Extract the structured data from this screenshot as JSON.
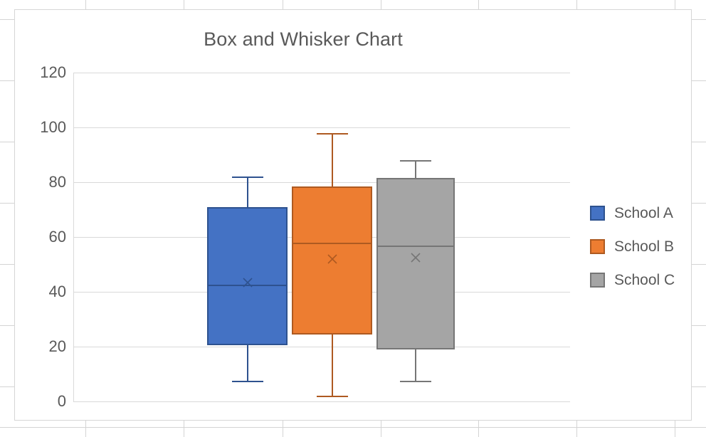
{
  "app": {
    "background_type": "spreadsheet-grid",
    "grid_color": "#d4d4d4",
    "chart_border_color": "#d6d6d6"
  },
  "chart": {
    "title": "Box and Whisker Chart",
    "title_color": "#595959",
    "axis_label_color": "#595959",
    "gridline_color": "#d9d9d9",
    "legend_position": "right"
  },
  "legend": {
    "items": [
      {
        "label": "School A",
        "color": "#4472C4",
        "border": "#2E528F"
      },
      {
        "label": "School B",
        "color": "#ED7D31",
        "border": "#AE5A21"
      },
      {
        "label": "School C",
        "color": "#A5A5A5",
        "border": "#767676"
      }
    ]
  },
  "y_axis": {
    "ticks": [
      "0",
      "20",
      "40",
      "60",
      "80",
      "100",
      "120"
    ],
    "min": 0,
    "max": 120,
    "step": 20
  },
  "chart_data": {
    "type": "box",
    "title": "Box and Whisker Chart",
    "xlabel": "",
    "ylabel": "",
    "ylim": [
      0,
      120
    ],
    "ytick_step": 20,
    "grid": true,
    "legend_position": "right",
    "categories": [
      "School A",
      "School B",
      "School C"
    ],
    "series": [
      {
        "name": "School A",
        "color": "#4472C4",
        "border_color": "#2E528F",
        "min": 7,
        "q1": 20.5,
        "median": 42.5,
        "mean": 43.5,
        "q3": 71,
        "max": 82
      },
      {
        "name": "School B",
        "color": "#ED7D31",
        "border_color": "#AE5A21",
        "min": 1.5,
        "q1": 24.5,
        "median": 58,
        "mean": 52,
        "q3": 78.5,
        "max": 98
      },
      {
        "name": "School C",
        "color": "#A5A5A5",
        "border_color": "#767676",
        "min": 7,
        "q1": 19,
        "median": 57,
        "mean": 52.5,
        "q3": 81.5,
        "max": 88
      }
    ]
  }
}
